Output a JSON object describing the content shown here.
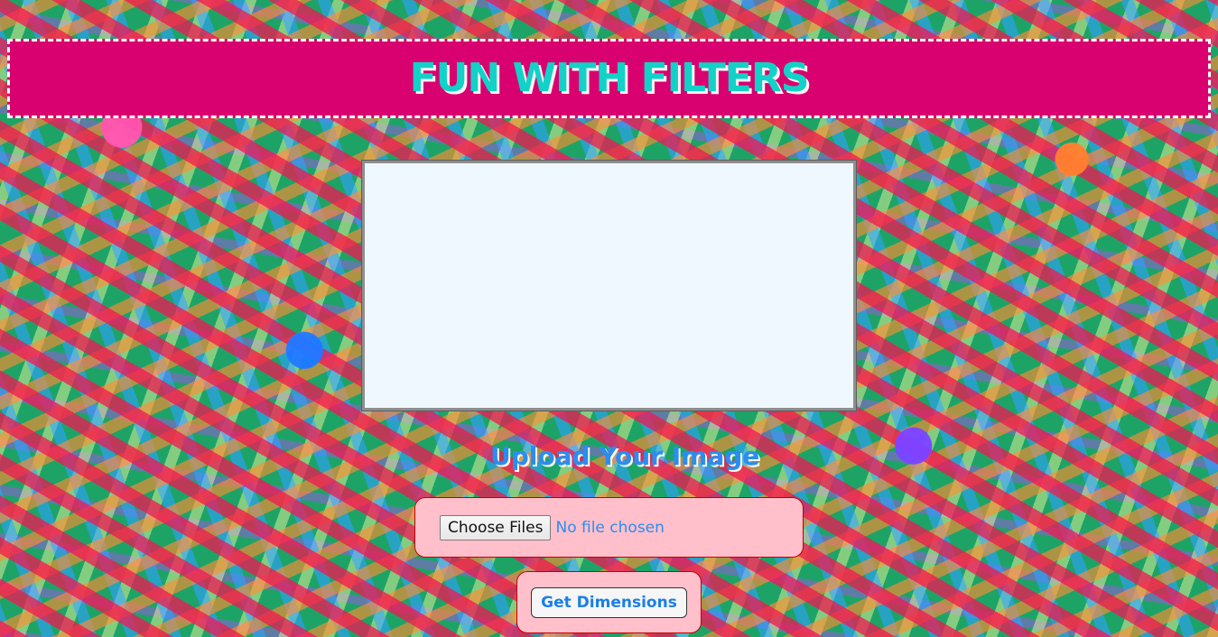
{
  "header": {
    "title": "FUN WITH FILTERS"
  },
  "preview": {
    "label": ""
  },
  "upload": {
    "heading": "Upload Your Image",
    "choose_files_label": "Choose Files",
    "status_text": "No file chosen"
  },
  "actions": {
    "get_dimensions_label": "Get Dimensions"
  },
  "colors": {
    "header_bg": "#d9006f",
    "title_teal": "#12d2c8",
    "accent_blue": "#2b8df0",
    "box_pink": "#ffc0cb",
    "border_red": "#c00000",
    "preview_bg": "#f0f8ff"
  }
}
